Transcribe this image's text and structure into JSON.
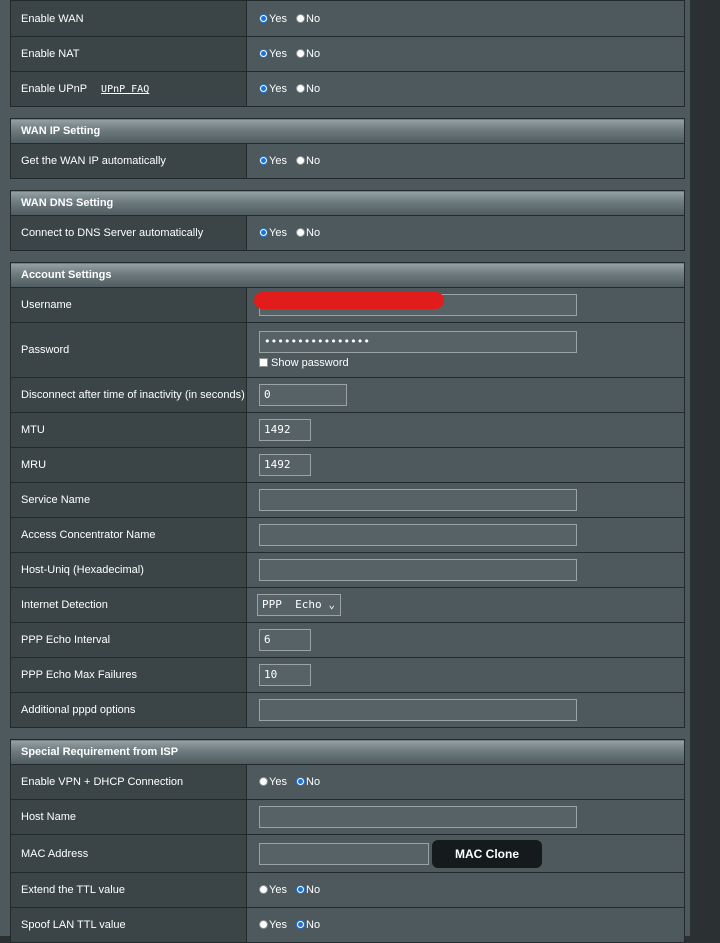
{
  "basic": {
    "enable_wan": {
      "label": "Enable WAN",
      "yes": "Yes",
      "no": "No",
      "value": "yes"
    },
    "enable_nat": {
      "label": "Enable NAT",
      "yes": "Yes",
      "no": "No",
      "value": "yes"
    },
    "enable_upnp": {
      "label": "Enable UPnP",
      "faq": "UPnP  FAQ",
      "yes": "Yes",
      "no": "No",
      "value": "yes"
    }
  },
  "wan_ip": {
    "title": "WAN IP Setting",
    "auto": {
      "label": "Get the WAN IP automatically",
      "yes": "Yes",
      "no": "No",
      "value": "yes"
    }
  },
  "wan_dns": {
    "title": "WAN DNS Setting",
    "auto": {
      "label": "Connect to DNS Server automatically",
      "yes": "Yes",
      "no": "No",
      "value": "yes"
    }
  },
  "account": {
    "title": "Account Settings",
    "username_label": "Username",
    "username_value": "",
    "password_label": "Password",
    "password_value": "••••••••••••••••",
    "show_password": "Show password",
    "idle_label": "Disconnect after time of inactivity (in seconds)",
    "idle_value": "0",
    "mtu_label": "MTU",
    "mtu_value": "1492",
    "mru_label": "MRU",
    "mru_value": "1492",
    "service_label": "Service Name",
    "service_value": "",
    "ac_label": "Access Concentrator Name",
    "ac_value": "",
    "hostuniq_label": "Host-Uniq (Hexadecimal)",
    "hostuniq_value": "",
    "detection_label": "Internet Detection",
    "detection_value": "PPP  Echo",
    "echo_interval_label": "PPP Echo Interval",
    "echo_interval_value": "6",
    "echo_fail_label": "PPP Echo Max Failures",
    "echo_fail_value": "10",
    "pppd_label": "Additional pppd options",
    "pppd_value": ""
  },
  "isp": {
    "title": "Special Requirement from ISP",
    "vpn_dhcp": {
      "label": "Enable VPN + DHCP Connection",
      "yes": "Yes",
      "no": "No",
      "value": "no"
    },
    "hostname_label": "Host Name",
    "hostname_value": "",
    "mac_label": "MAC Address",
    "mac_value": "",
    "mac_clone": "MAC Clone",
    "extend_ttl": {
      "label": "Extend the TTL value",
      "yes": "Yes",
      "no": "No",
      "value": "no"
    },
    "spoof_ttl": {
      "label": "Spoof LAN TTL value",
      "yes": "Yes",
      "no": "No",
      "value": "no"
    }
  },
  "colors": {
    "accent": "#1e72d8",
    "panel": "#4d595d",
    "label_bg": "#3b4548",
    "redaction": "#e21b1b"
  }
}
